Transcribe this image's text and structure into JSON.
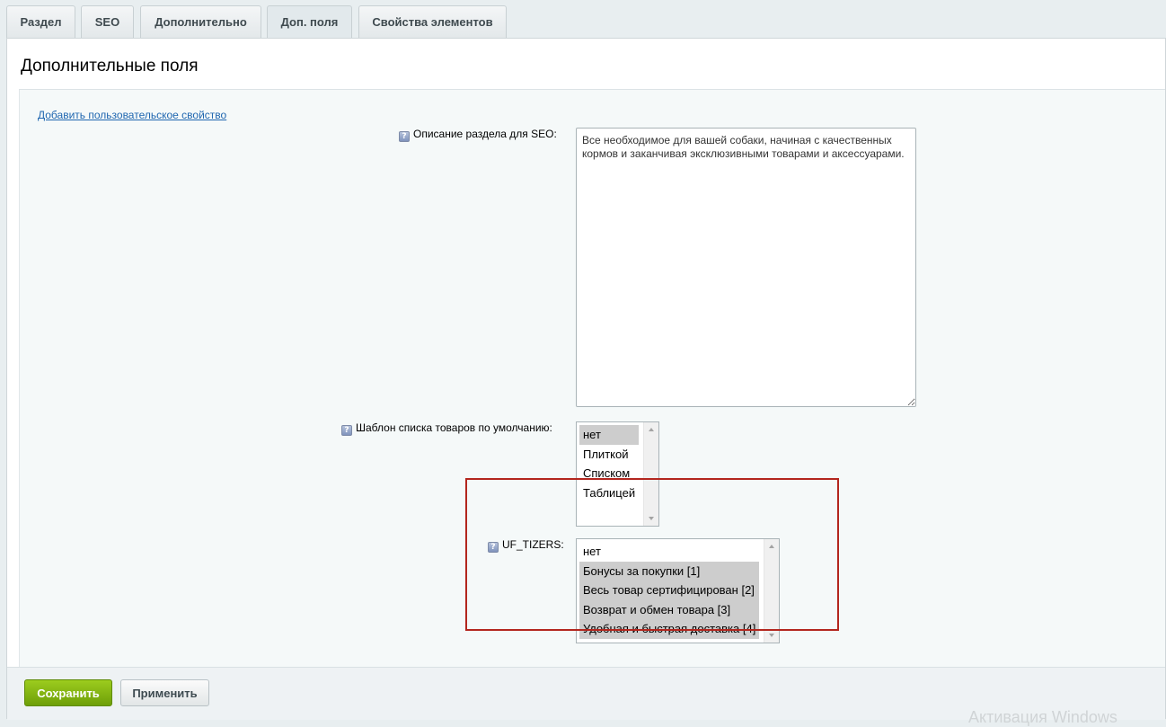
{
  "tabs": [
    {
      "label": "Раздел"
    },
    {
      "label": "SEO"
    },
    {
      "label": "Дополнительно"
    },
    {
      "label": "Доп. поля",
      "active": true
    },
    {
      "label": "Свойства элементов"
    }
  ],
  "panel": {
    "title": "Дополнительные поля",
    "add_link": "Добавить пользовательское свойство"
  },
  "fields": {
    "seo_description": {
      "help": "?",
      "label": "Описание раздела для SEO:",
      "value": "Все необходимое для вашей собаки, начиная с качественных кормов и заканчивая эксклюзивными товарами и аксессуарами."
    },
    "list_template": {
      "help": "?",
      "label": "Шаблон списка товаров по умолчанию:",
      "options": [
        {
          "label": "нет",
          "selected": true
        },
        {
          "label": "Плиткой",
          "selected": false
        },
        {
          "label": "Списком",
          "selected": false
        },
        {
          "label": "Таблицей",
          "selected": false
        }
      ]
    },
    "uf_tizers": {
      "help": "?",
      "label": "UF_TIZERS:",
      "options": [
        {
          "label": "нет",
          "selected": false
        },
        {
          "label": "Бонусы за покупки [1]",
          "selected": true
        },
        {
          "label": "Весь товар сертифицирован [2]",
          "selected": true
        },
        {
          "label": "Возврат и обмен товара [3]",
          "selected": true
        },
        {
          "label": "Удобная и быстрая доставка [4]",
          "selected": true
        }
      ]
    }
  },
  "footer": {
    "save_label": "Сохранить",
    "apply_label": "Применить"
  },
  "watermark": "Активация Windows",
  "colors": {
    "save_button": "#7db412",
    "highlight_box": "#b3261e",
    "link": "#2067b0",
    "selected_option": "#cdcdcd"
  }
}
